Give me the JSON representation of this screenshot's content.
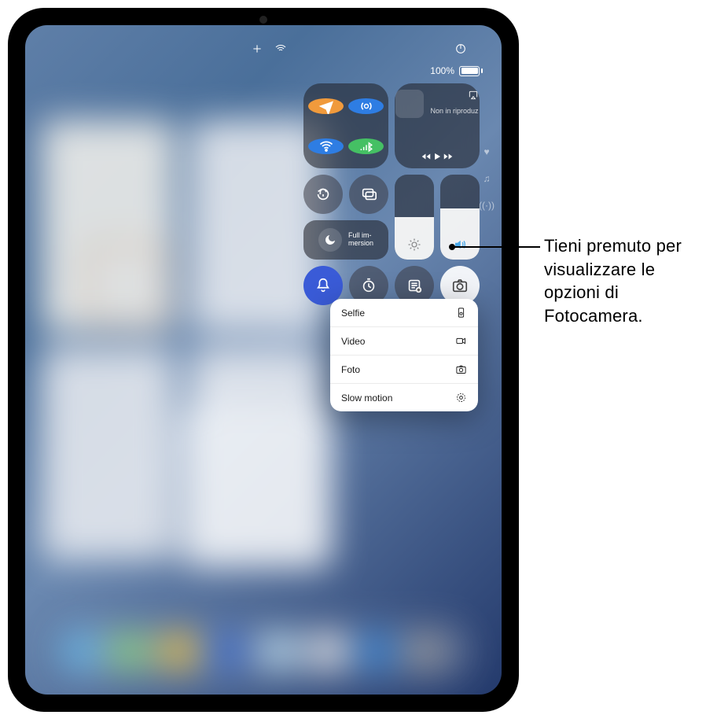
{
  "status": {
    "battery_pct": "100%"
  },
  "media": {
    "not_playing": "Non in riproduz"
  },
  "focus": {
    "label": "Full im-\nmersion"
  },
  "camera_menu": {
    "items": [
      {
        "label": "Selfie",
        "icon": "selfie-icon"
      },
      {
        "label": "Video",
        "icon": "video-icon"
      },
      {
        "label": "Foto",
        "icon": "photo-icon"
      },
      {
        "label": "Slow motion",
        "icon": "slomo-icon"
      }
    ]
  },
  "callout": {
    "text": "Tieni premuto per visualizzare le opzioni di Fotocamera."
  }
}
